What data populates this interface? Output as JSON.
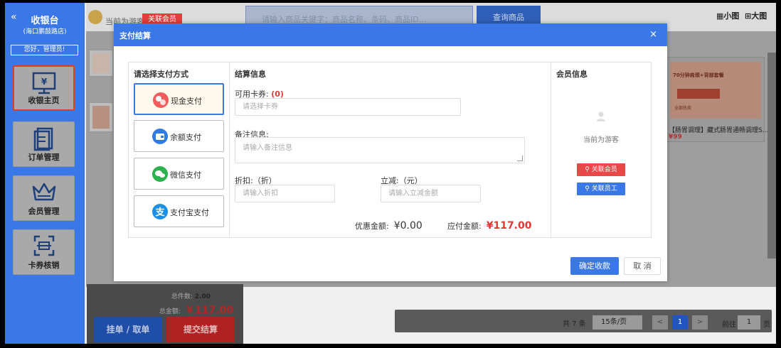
{
  "sidebar": {
    "collapse_icon": "«",
    "title": "收银台",
    "subtitle": "(海口鹏鼓路店)",
    "greeting": "您好，管理员!",
    "items": [
      {
        "label": "收银主页",
        "icon": "cashier-icon",
        "active": true
      },
      {
        "label": "订单管理",
        "icon": "orders-icon",
        "active": false
      },
      {
        "label": "会员管理",
        "icon": "crown-icon",
        "active": false
      },
      {
        "label": "卡券核销",
        "icon": "scan-icon",
        "active": false
      }
    ]
  },
  "topbar": {
    "visitor_text": "当前为游客",
    "link_member": "关联会员",
    "search_placeholder": "请输入商品关键字：商品名称、条码、商品ID...",
    "search_button": "查询商品",
    "view_small": "小图",
    "view_large": "大图"
  },
  "product_right": {
    "ad_text": "70分钟肩颈+背部套餐",
    "ad_small": "全部热卖",
    "name": "【肠胃调理】藏式肠胃通畅调理S...",
    "price": "¥99"
  },
  "summary": {
    "total_count_label": "总件数:",
    "total_count": "2.00",
    "total_amount_label": "总金额:",
    "total_amount": "￥117.00",
    "hold_button": "挂单 / 取单",
    "submit_button": "提交结算"
  },
  "pager": {
    "total": "共 7 条",
    "page_size": "15条/页",
    "prev": "<",
    "current": "1",
    "next": ">",
    "goto_label": "前往",
    "goto_value": "1",
    "page_label": "页"
  },
  "modal": {
    "title": "支付结算",
    "close": "×",
    "pay_title": "请选择支付方式",
    "pay_options": [
      {
        "label": "现金支付",
        "icon": "cash-icon",
        "color": "#f25c5c",
        "selected": true
      },
      {
        "label": "余额支付",
        "icon": "wallet-icon",
        "color": "#2f7ae5",
        "selected": false
      },
      {
        "label": "微信支付",
        "icon": "wechat-icon",
        "color": "#2bb24c",
        "selected": false
      },
      {
        "label": "支付宝支付",
        "icon": "alipay-icon",
        "color": "#1a8fe8",
        "selected": false
      }
    ],
    "settle_title": "结算信息",
    "coupon_label": "可用卡券:",
    "coupon_count": "(0)",
    "coupon_placeholder": "请选择卡券",
    "remark_label": "备注信息:",
    "remark_placeholder": "请输入备注信息",
    "discount_label": "折扣:（折）",
    "discount_placeholder": "请输入折扣",
    "reduce_label": "立减:（元）",
    "reduce_placeholder": "请输入立减金额",
    "discount_amount_label": "优惠金额:",
    "discount_amount": "¥0.00",
    "payable_label": "应付金额:",
    "payable_amount": "¥117.00",
    "member_title": "会员信息",
    "member_empty": "当前为游客",
    "link_member": "关联会员",
    "link_staff": "关联员工",
    "confirm": "确定收款",
    "cancel": "取 消"
  },
  "colors": {
    "primary": "#3b78e7",
    "danger": "#e53535"
  }
}
